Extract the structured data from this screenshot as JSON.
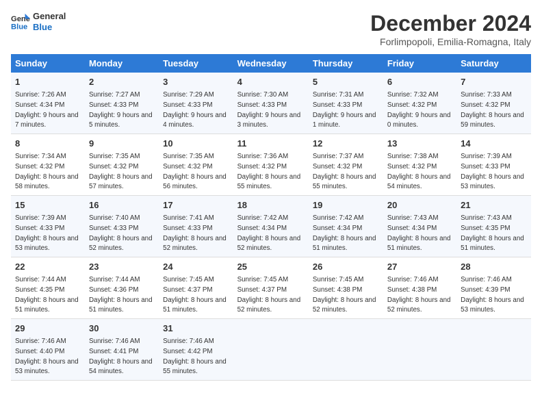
{
  "header": {
    "logo_line1": "General",
    "logo_line2": "Blue",
    "month_title": "December 2024",
    "location": "Forlimpopoli, Emilia-Romagna, Italy"
  },
  "columns": [
    "Sunday",
    "Monday",
    "Tuesday",
    "Wednesday",
    "Thursday",
    "Friday",
    "Saturday"
  ],
  "weeks": [
    [
      {
        "day": "1",
        "sunrise": "7:26 AM",
        "sunset": "4:34 PM",
        "daylight": "9 hours and 7 minutes."
      },
      {
        "day": "2",
        "sunrise": "7:27 AM",
        "sunset": "4:33 PM",
        "daylight": "9 hours and 5 minutes."
      },
      {
        "day": "3",
        "sunrise": "7:29 AM",
        "sunset": "4:33 PM",
        "daylight": "9 hours and 4 minutes."
      },
      {
        "day": "4",
        "sunrise": "7:30 AM",
        "sunset": "4:33 PM",
        "daylight": "9 hours and 3 minutes."
      },
      {
        "day": "5",
        "sunrise": "7:31 AM",
        "sunset": "4:33 PM",
        "daylight": "9 hours and 1 minute."
      },
      {
        "day": "6",
        "sunrise": "7:32 AM",
        "sunset": "4:32 PM",
        "daylight": "9 hours and 0 minutes."
      },
      {
        "day": "7",
        "sunrise": "7:33 AM",
        "sunset": "4:32 PM",
        "daylight": "8 hours and 59 minutes."
      }
    ],
    [
      {
        "day": "8",
        "sunrise": "7:34 AM",
        "sunset": "4:32 PM",
        "daylight": "8 hours and 58 minutes."
      },
      {
        "day": "9",
        "sunrise": "7:35 AM",
        "sunset": "4:32 PM",
        "daylight": "8 hours and 57 minutes."
      },
      {
        "day": "10",
        "sunrise": "7:35 AM",
        "sunset": "4:32 PM",
        "daylight": "8 hours and 56 minutes."
      },
      {
        "day": "11",
        "sunrise": "7:36 AM",
        "sunset": "4:32 PM",
        "daylight": "8 hours and 55 minutes."
      },
      {
        "day": "12",
        "sunrise": "7:37 AM",
        "sunset": "4:32 PM",
        "daylight": "8 hours and 55 minutes."
      },
      {
        "day": "13",
        "sunrise": "7:38 AM",
        "sunset": "4:32 PM",
        "daylight": "8 hours and 54 minutes."
      },
      {
        "day": "14",
        "sunrise": "7:39 AM",
        "sunset": "4:33 PM",
        "daylight": "8 hours and 53 minutes."
      }
    ],
    [
      {
        "day": "15",
        "sunrise": "7:39 AM",
        "sunset": "4:33 PM",
        "daylight": "8 hours and 53 minutes."
      },
      {
        "day": "16",
        "sunrise": "7:40 AM",
        "sunset": "4:33 PM",
        "daylight": "8 hours and 52 minutes."
      },
      {
        "day": "17",
        "sunrise": "7:41 AM",
        "sunset": "4:33 PM",
        "daylight": "8 hours and 52 minutes."
      },
      {
        "day": "18",
        "sunrise": "7:42 AM",
        "sunset": "4:34 PM",
        "daylight": "8 hours and 52 minutes."
      },
      {
        "day": "19",
        "sunrise": "7:42 AM",
        "sunset": "4:34 PM",
        "daylight": "8 hours and 51 minutes."
      },
      {
        "day": "20",
        "sunrise": "7:43 AM",
        "sunset": "4:34 PM",
        "daylight": "8 hours and 51 minutes."
      },
      {
        "day": "21",
        "sunrise": "7:43 AM",
        "sunset": "4:35 PM",
        "daylight": "8 hours and 51 minutes."
      }
    ],
    [
      {
        "day": "22",
        "sunrise": "7:44 AM",
        "sunset": "4:35 PM",
        "daylight": "8 hours and 51 minutes."
      },
      {
        "day": "23",
        "sunrise": "7:44 AM",
        "sunset": "4:36 PM",
        "daylight": "8 hours and 51 minutes."
      },
      {
        "day": "24",
        "sunrise": "7:45 AM",
        "sunset": "4:37 PM",
        "daylight": "8 hours and 51 minutes."
      },
      {
        "day": "25",
        "sunrise": "7:45 AM",
        "sunset": "4:37 PM",
        "daylight": "8 hours and 52 minutes."
      },
      {
        "day": "26",
        "sunrise": "7:45 AM",
        "sunset": "4:38 PM",
        "daylight": "8 hours and 52 minutes."
      },
      {
        "day": "27",
        "sunrise": "7:46 AM",
        "sunset": "4:38 PM",
        "daylight": "8 hours and 52 minutes."
      },
      {
        "day": "28",
        "sunrise": "7:46 AM",
        "sunset": "4:39 PM",
        "daylight": "8 hours and 53 minutes."
      }
    ],
    [
      {
        "day": "29",
        "sunrise": "7:46 AM",
        "sunset": "4:40 PM",
        "daylight": "8 hours and 53 minutes."
      },
      {
        "day": "30",
        "sunrise": "7:46 AM",
        "sunset": "4:41 PM",
        "daylight": "8 hours and 54 minutes."
      },
      {
        "day": "31",
        "sunrise": "7:46 AM",
        "sunset": "4:42 PM",
        "daylight": "8 hours and 55 minutes."
      },
      null,
      null,
      null,
      null
    ]
  ]
}
